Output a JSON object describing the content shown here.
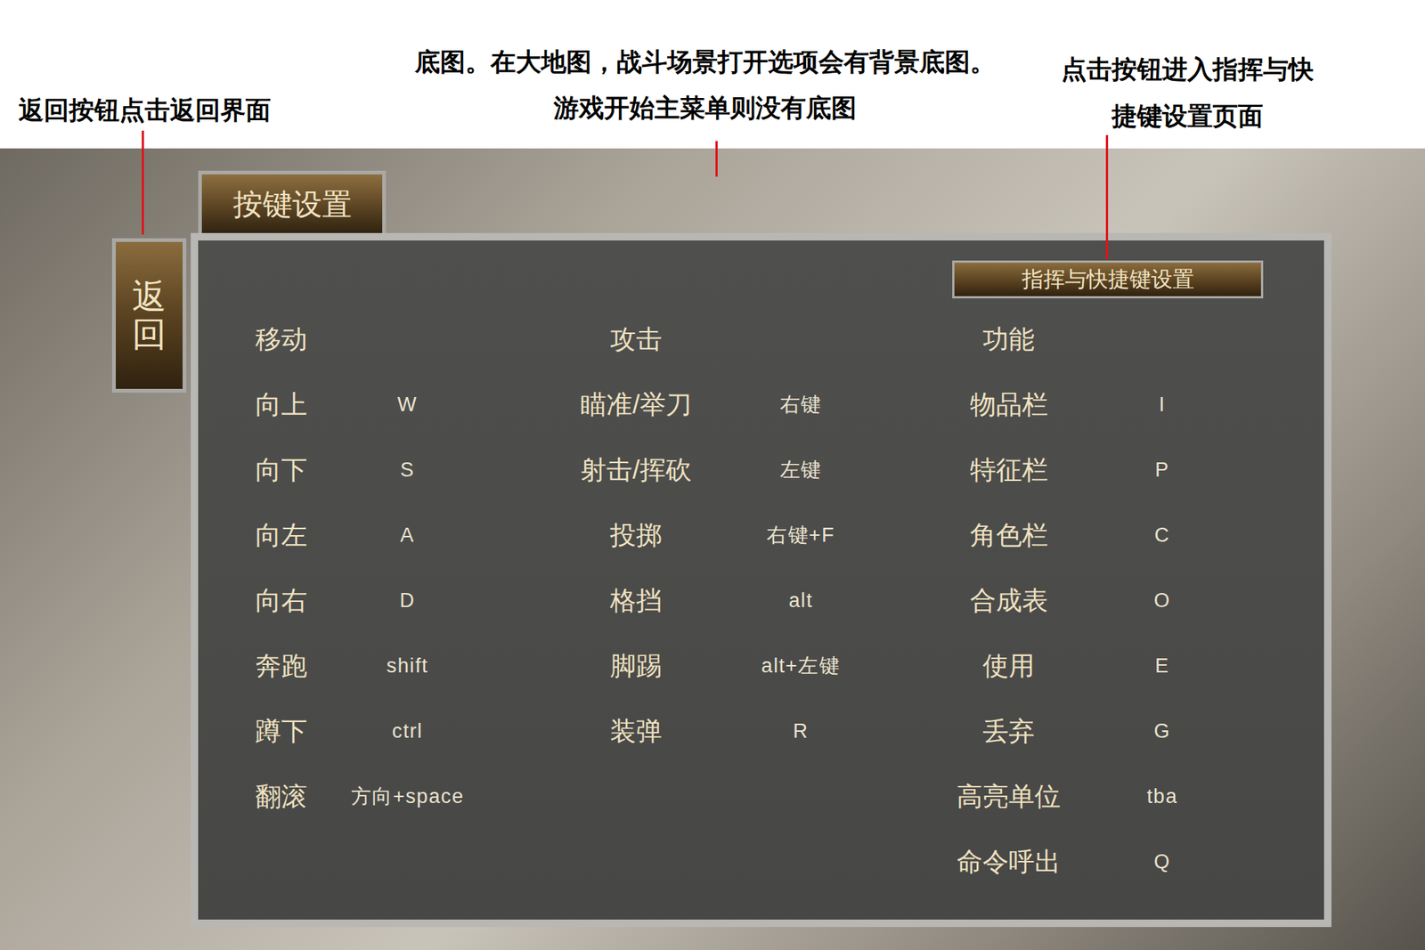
{
  "annotations": [
    {
      "lines": [
        "返回按钮点击返回界面"
      ]
    },
    {
      "lines": [
        "底图。在大地图，战斗场景打开选项会有背景底图。",
        "游戏开始主菜单则没有底图"
      ]
    },
    {
      "lines": [
        "点击按钮进入指挥与快",
        "捷键设置页面"
      ]
    }
  ],
  "back_button": "返回",
  "title_tab": "按键设置",
  "shortcut_button": "指挥与快捷键设置",
  "groups": [
    {
      "title": "移动",
      "bindings": [
        {
          "action": "向上",
          "key": "W"
        },
        {
          "action": "向下",
          "key": "S"
        },
        {
          "action": "向左",
          "key": "A"
        },
        {
          "action": "向右",
          "key": "D"
        },
        {
          "action": "奔跑",
          "key": "shift"
        },
        {
          "action": "蹲下",
          "key": "ctrl"
        },
        {
          "action": "翻滚",
          "key": "方向+space"
        }
      ]
    },
    {
      "title": "攻击",
      "bindings": [
        {
          "action": "瞄准/举刀",
          "key": "右键"
        },
        {
          "action": "射击/挥砍",
          "key": "左键"
        },
        {
          "action": "投掷",
          "key": "右键+F"
        },
        {
          "action": "格挡",
          "key": "alt"
        },
        {
          "action": "脚踢",
          "key": "alt+左键"
        },
        {
          "action": "装弹",
          "key": "R"
        }
      ]
    },
    {
      "title": "功能",
      "bindings": [
        {
          "action": "物品栏",
          "key": "I"
        },
        {
          "action": "特征栏",
          "key": "P"
        },
        {
          "action": "角色栏",
          "key": "C"
        },
        {
          "action": "合成表",
          "key": "O"
        },
        {
          "action": "使用",
          "key": "E"
        },
        {
          "action": "丢弃",
          "key": "G"
        },
        {
          "action": "高亮单位",
          "key": "tba"
        },
        {
          "action": "命令呼出",
          "key": "Q"
        }
      ]
    }
  ]
}
